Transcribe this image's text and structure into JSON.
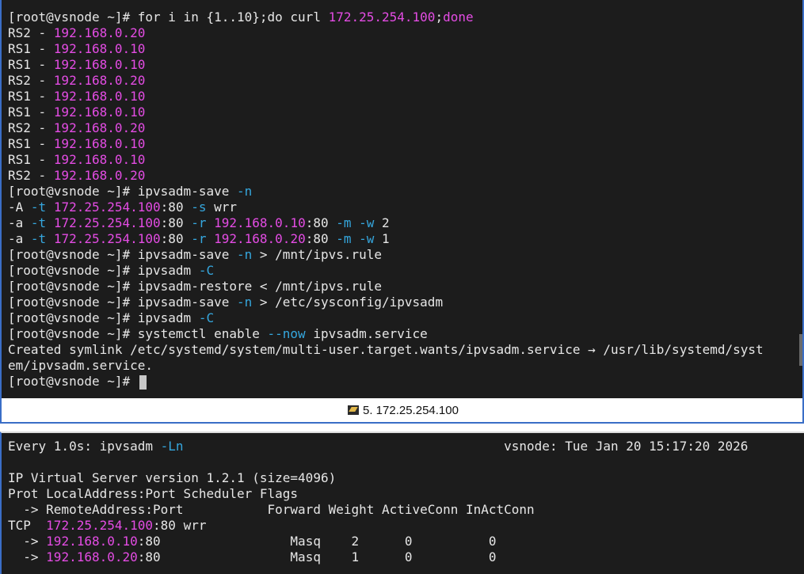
{
  "top_terminal": {
    "lines": [
      [
        [
          "[root@vsnode ~]# for i in {1..10};do curl ",
          "default"
        ],
        [
          "172.25.254.100",
          "magenta"
        ],
        [
          ";",
          "default"
        ],
        [
          "done",
          "magenta"
        ]
      ],
      [
        [
          "RS2 - ",
          "default"
        ],
        [
          "192.168.0.20",
          "magenta"
        ]
      ],
      [
        [
          "RS1 - ",
          "default"
        ],
        [
          "192.168.0.10",
          "magenta"
        ]
      ],
      [
        [
          "RS1 - ",
          "default"
        ],
        [
          "192.168.0.10",
          "magenta"
        ]
      ],
      [
        [
          "RS2 - ",
          "default"
        ],
        [
          "192.168.0.20",
          "magenta"
        ]
      ],
      [
        [
          "RS1 - ",
          "default"
        ],
        [
          "192.168.0.10",
          "magenta"
        ]
      ],
      [
        [
          "RS1 - ",
          "default"
        ],
        [
          "192.168.0.10",
          "magenta"
        ]
      ],
      [
        [
          "RS2 - ",
          "default"
        ],
        [
          "192.168.0.20",
          "magenta"
        ]
      ],
      [
        [
          "RS1 - ",
          "default"
        ],
        [
          "192.168.0.10",
          "magenta"
        ]
      ],
      [
        [
          "RS1 - ",
          "default"
        ],
        [
          "192.168.0.10",
          "magenta"
        ]
      ],
      [
        [
          "RS2 - ",
          "default"
        ],
        [
          "192.168.0.20",
          "magenta"
        ]
      ],
      [
        [
          "[root@vsnode ~]# ipvsadm-save ",
          "default"
        ],
        [
          "-n",
          "cyan"
        ]
      ],
      [
        [
          "-A ",
          "default"
        ],
        [
          "-t",
          "cyan"
        ],
        [
          " ",
          "default"
        ],
        [
          "172.25.254.100",
          "magenta"
        ],
        [
          ":80 ",
          "default"
        ],
        [
          "-s",
          "cyan"
        ],
        [
          " wrr",
          "default"
        ]
      ],
      [
        [
          "-a ",
          "default"
        ],
        [
          "-t",
          "cyan"
        ],
        [
          " ",
          "default"
        ],
        [
          "172.25.254.100",
          "magenta"
        ],
        [
          ":80 ",
          "default"
        ],
        [
          "-r",
          "cyan"
        ],
        [
          " ",
          "default"
        ],
        [
          "192.168.0.10",
          "magenta"
        ],
        [
          ":80 ",
          "default"
        ],
        [
          "-m",
          "cyan"
        ],
        [
          " ",
          "default"
        ],
        [
          "-w",
          "cyan"
        ],
        [
          " 2",
          "default"
        ]
      ],
      [
        [
          "-a ",
          "default"
        ],
        [
          "-t",
          "cyan"
        ],
        [
          " ",
          "default"
        ],
        [
          "172.25.254.100",
          "magenta"
        ],
        [
          ":80 ",
          "default"
        ],
        [
          "-r",
          "cyan"
        ],
        [
          " ",
          "default"
        ],
        [
          "192.168.0.20",
          "magenta"
        ],
        [
          ":80 ",
          "default"
        ],
        [
          "-m",
          "cyan"
        ],
        [
          " ",
          "default"
        ],
        [
          "-w",
          "cyan"
        ],
        [
          " 1",
          "default"
        ]
      ],
      [
        [
          "[root@vsnode ~]# ipvsadm-save ",
          "default"
        ],
        [
          "-n",
          "cyan"
        ],
        [
          " > /mnt/ipvs.rule",
          "default"
        ]
      ],
      [
        [
          "[root@vsnode ~]# ipvsadm ",
          "default"
        ],
        [
          "-C",
          "cyan"
        ]
      ],
      [
        [
          "[root@vsnode ~]# ipvsadm-restore < /mnt/ipvs.rule",
          "default"
        ]
      ],
      [
        [
          "[root@vsnode ~]# ipvsadm-save ",
          "default"
        ],
        [
          "-n",
          "cyan"
        ],
        [
          " > /etc/sysconfig/ipvsadm",
          "default"
        ]
      ],
      [
        [
          "[root@vsnode ~]# ipvsadm ",
          "default"
        ],
        [
          "-C",
          "cyan"
        ]
      ],
      [
        [
          "[root@vsnode ~]# systemctl enable ",
          "default"
        ],
        [
          "--now",
          "cyan"
        ],
        [
          " ipvsadm.service",
          "default"
        ]
      ],
      [
        [
          "Created symlink /etc/systemd/system/multi-user.target.wants/ipvsadm.service → /usr/lib/systemd/syst",
          "default"
        ]
      ],
      [
        [
          "em/ipvsadm.service.",
          "default"
        ]
      ],
      [
        [
          "[root@vsnode ~]# ",
          "default"
        ]
      ]
    ]
  },
  "tab_bar": {
    "icon": "terminal-session-icon",
    "label": "5. 172.25.254.100"
  },
  "bottom_terminal": {
    "lines": [
      [
        [
          "Every 1.0s: ipvsadm ",
          "default"
        ],
        [
          "-Ln",
          "cyan"
        ],
        [
          "                                          vsnode: Tue Jan 20 15:17:20 2026",
          "default"
        ]
      ],
      [
        [
          "",
          "default"
        ]
      ],
      [
        [
          "IP Virtual Server version 1.2.1 (size=4096)",
          "default"
        ]
      ],
      [
        [
          "Prot LocalAddress:Port Scheduler Flags",
          "default"
        ]
      ],
      [
        [
          "  -> RemoteAddress:Port           Forward Weight ActiveConn InActConn",
          "default"
        ]
      ],
      [
        [
          "TCP  ",
          "default"
        ],
        [
          "172.25.254.100",
          "magenta"
        ],
        [
          ":80 wrr",
          "default"
        ]
      ],
      [
        [
          "  -> ",
          "default"
        ],
        [
          "192.168.0.10",
          "magenta"
        ],
        [
          ":80                 Masq    2      0          0",
          "default"
        ]
      ],
      [
        [
          "  -> ",
          "default"
        ],
        [
          "192.168.0.20",
          "magenta"
        ],
        [
          ":80                 Masq    1      0          0",
          "default"
        ]
      ]
    ]
  },
  "colors": {
    "background": "#1c1c1c",
    "text": "#e6e6e6",
    "ip_highlight": "#e44ce4",
    "option_flag": "#35a7de",
    "border": "#3a6ec7"
  }
}
